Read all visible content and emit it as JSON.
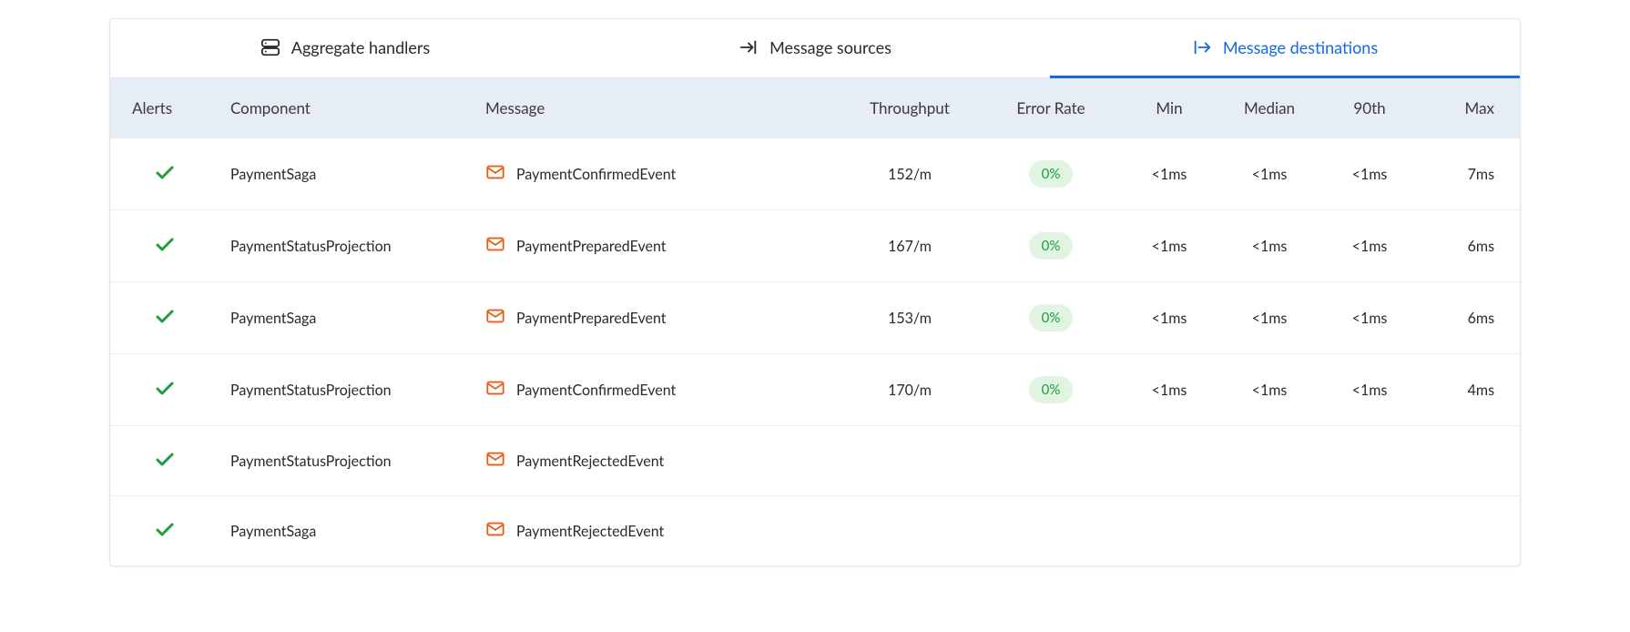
{
  "tabs": {
    "aggregate": "Aggregate handlers",
    "sources": "Message sources",
    "destinations": "Message destinations"
  },
  "columns": {
    "alerts": "Alerts",
    "component": "Component",
    "message": "Message",
    "throughput": "Throughput",
    "error_rate": "Error Rate",
    "min": "Min",
    "median": "Median",
    "p90": "90th",
    "max": "Max"
  },
  "rows": [
    {
      "status": "ok",
      "component": "PaymentSaga",
      "message": "PaymentConfirmedEvent",
      "throughput": "152/m",
      "error_rate": "0%",
      "min": "<1ms",
      "median": "<1ms",
      "p90": "<1ms",
      "max": "7ms"
    },
    {
      "status": "ok",
      "component": "PaymentStatusProjection",
      "message": "PaymentPreparedEvent",
      "throughput": "167/m",
      "error_rate": "0%",
      "min": "<1ms",
      "median": "<1ms",
      "p90": "<1ms",
      "max": "6ms"
    },
    {
      "status": "ok",
      "component": "PaymentSaga",
      "message": "PaymentPreparedEvent",
      "throughput": "153/m",
      "error_rate": "0%",
      "min": "<1ms",
      "median": "<1ms",
      "p90": "<1ms",
      "max": "6ms"
    },
    {
      "status": "ok",
      "component": "PaymentStatusProjection",
      "message": "PaymentConfirmedEvent",
      "throughput": "170/m",
      "error_rate": "0%",
      "min": "<1ms",
      "median": "<1ms",
      "p90": "<1ms",
      "max": "4ms"
    },
    {
      "status": "ok",
      "component": "PaymentStatusProjection",
      "message": "PaymentRejectedEvent",
      "throughput": "",
      "error_rate": "",
      "min": "",
      "median": "",
      "p90": "",
      "max": ""
    },
    {
      "status": "ok",
      "component": "PaymentSaga",
      "message": "PaymentRejectedEvent",
      "throughput": "",
      "error_rate": "",
      "min": "",
      "median": "",
      "p90": "",
      "max": ""
    }
  ],
  "icons": {
    "aggregate": "server-icon",
    "sources": "arrow-in-icon",
    "destinations": "arrow-out-icon",
    "status_ok": "check-icon",
    "message": "mail-icon"
  }
}
